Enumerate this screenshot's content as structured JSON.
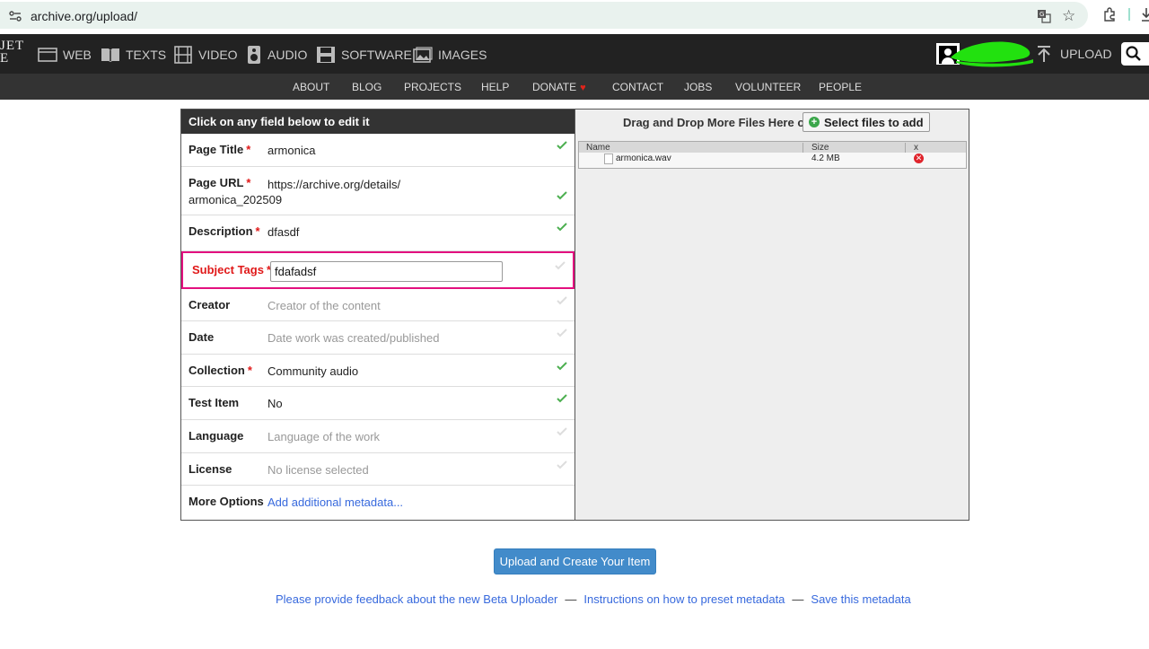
{
  "browser": {
    "url": "archive.org/upload/"
  },
  "logo": {
    "line1": "JET",
    "line2": "E"
  },
  "nav": [
    {
      "label": "WEB",
      "icon": "web-icon"
    },
    {
      "label": "TEXTS",
      "icon": "texts-icon"
    },
    {
      "label": "VIDEO",
      "icon": "video-icon"
    },
    {
      "label": "AUDIO",
      "icon": "audio-icon"
    },
    {
      "label": "SOFTWARE",
      "icon": "software-icon"
    },
    {
      "label": "IMAGES",
      "icon": "images-icon"
    }
  ],
  "upload_label": "UPLOAD",
  "subnav": [
    "ABOUT",
    "BLOG",
    "PROJECTS",
    "HELP",
    "DONATE",
    "CONTACT",
    "JOBS",
    "VOLUNTEER",
    "PEOPLE"
  ],
  "form": {
    "header": "Click on any field below to edit it",
    "fields": [
      {
        "label": "Page Title",
        "value": "armonica",
        "required": true
      },
      {
        "label": "Page URL",
        "value_line1": "https://archive.org/details/",
        "value_line2": "armonica_202509",
        "required": true
      },
      {
        "label": "Description",
        "value": "dfasdf",
        "required": true
      },
      {
        "label": "Subject Tags",
        "value": "fdafadsf",
        "required": true
      },
      {
        "label": "Creator",
        "value": "Creator of the content",
        "required": false
      },
      {
        "label": "Date",
        "value": "Date work was created/published",
        "required": false
      },
      {
        "label": "Collection",
        "value": "Community audio",
        "required": true
      },
      {
        "label": "Test Item",
        "value": "No",
        "required": false
      },
      {
        "label": "Language",
        "value": "Language of the work",
        "required": false
      },
      {
        "label": "License",
        "value": "No license selected",
        "required": false
      },
      {
        "label": "More Options",
        "value": "Add additional metadata...",
        "required": false
      }
    ],
    "required_mark": "*"
  },
  "files": {
    "drop_text": "Drag and Drop More Files Here or",
    "select_button": "Select files to add",
    "columns": [
      "Name",
      "Size",
      "x"
    ],
    "rows": [
      {
        "name": "armonica.wav",
        "size": "4.2 MB"
      }
    ]
  },
  "submit_label": "Upload and Create Your Item",
  "footer": {
    "feedback": "Please provide feedback about the new Beta Uploader",
    "instructions": "Instructions on how to preset metadata",
    "save": "Save this metadata",
    "separator": "—"
  },
  "colors": {
    "nav_bg": "#222222",
    "subnav_bg": "#333333",
    "highlight": "#e3107f",
    "required": "#e01818",
    "link": "#3769dd",
    "check": "#4caf50",
    "submit": "#428bca"
  }
}
